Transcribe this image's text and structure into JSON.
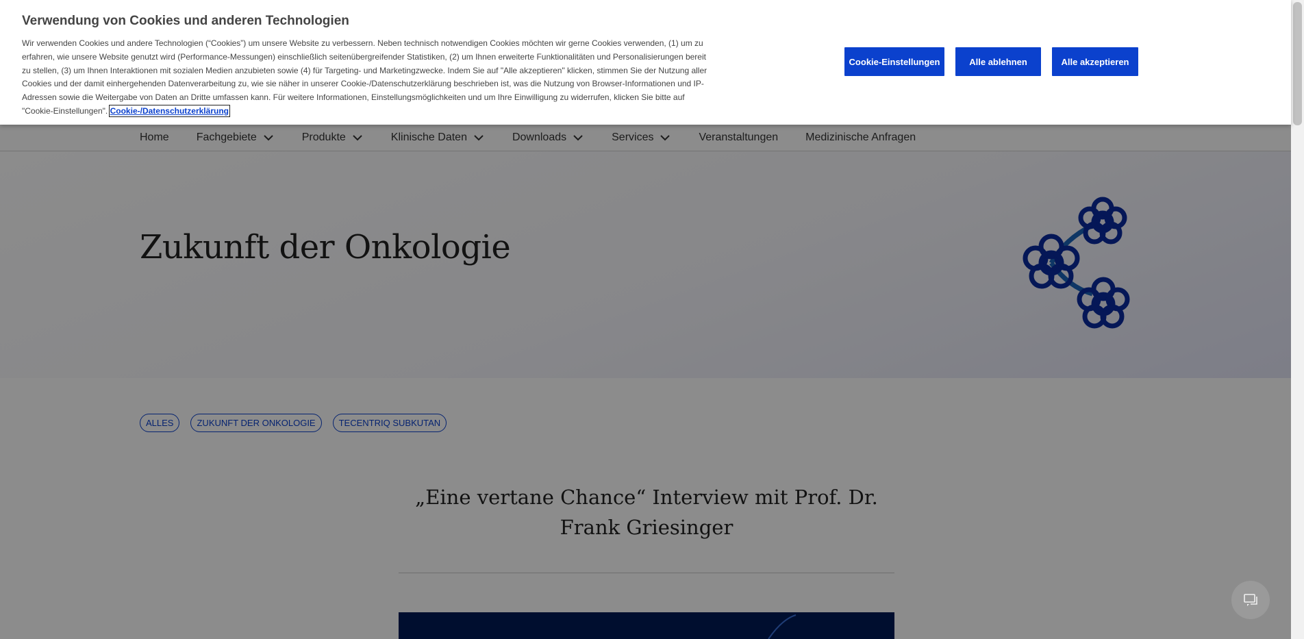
{
  "cookie_banner": {
    "title": "Verwendung von Cookies und anderen Technologien",
    "body": "Wir verwenden Cookies und andere Technologien (“Cookies”) um unsere Website zu verbessern. Neben technisch notwendigen Cookies möchten wir gerne Cookies verwenden, (1) um zu erfahren, wie unsere Website genutzt wird (Performance-Messungen) einschließlich seitenübergreifender Statistiken, (2) um Ihnen erweiterte Funktionalitäten und Personalisierungen bereit zu stellen, (3) um Ihnen Interaktionen mit sozialen Medien anzubieten sowie (4) für Targeting- und Marketingzwecke. Indem Sie auf \"Alle akzeptieren\" klicken, stimmen Sie der Nutzung aller Cookies und der damit einhergehenden Datenverarbeitung zu, wie sie näher in unserer Cookie-/Datenschutzerklärung beschrieben ist, was die Nutzung von Browser-Informationen und IP-Adressen sowie die Weitergabe von Daten an Dritte umfassen kann. Für weitere Informationen, Einstellungsmöglichkeiten und um Ihre Einwilligung zu widerrufen, klicken Sie bitte auf \"Cookie-Einstellungen\".",
    "link": "Cookie-/Datenschutzerklärung",
    "buttons": {
      "settings": "Cookie-Einstellungen",
      "reject": "Alle ablehnen",
      "accept": "Alle akzeptieren"
    },
    "button_color": "#0b41cd"
  },
  "nav": {
    "items": [
      {
        "label": "Home"
      },
      {
        "label": "Fachgebiete"
      },
      {
        "label": "Produkte"
      },
      {
        "label": "Klinische Daten"
      },
      {
        "label": "Downloads"
      },
      {
        "label": "Services"
      },
      {
        "label": "Veranstaltungen"
      },
      {
        "label": "Medizinische Anfragen"
      }
    ]
  },
  "hero": {
    "title": "Zukunft der Onkologie",
    "icon": "flower-molecule-icon"
  },
  "tags": [
    "ALLES",
    "ZUKUNFT DER ONKOLOGIE",
    "TECENTRIQ SUBKUTAN"
  ],
  "article": {
    "title": "„Eine vertane Chance“ Interview mit Prof. Dr. Frank Griesinger"
  },
  "chat": {
    "icon": "chat-icon"
  }
}
